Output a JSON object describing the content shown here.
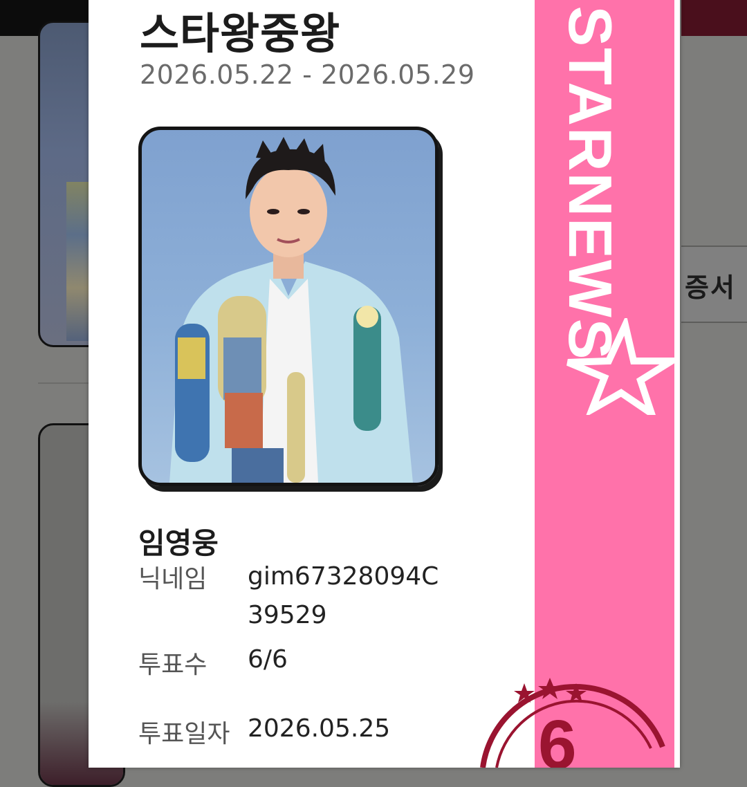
{
  "background": {
    "cert_label": "증서"
  },
  "card": {
    "title": "스타왕중왕",
    "period": "2026.05.22 - 2026.05.29",
    "name": "임영웅",
    "rows": [
      {
        "label": "닉네임",
        "value_line1": "gim67328094C",
        "value_line2": "39529"
      },
      {
        "label": "투표수",
        "value": "6/6"
      },
      {
        "label": "투표일자",
        "value": "2026.05.25"
      }
    ]
  },
  "brand": {
    "text": "STARNEWS",
    "strip_color": "#ff72aa",
    "star_icon": "star-outline-icon"
  },
  "stamp": {
    "number": "6",
    "color": "#9a1430"
  }
}
